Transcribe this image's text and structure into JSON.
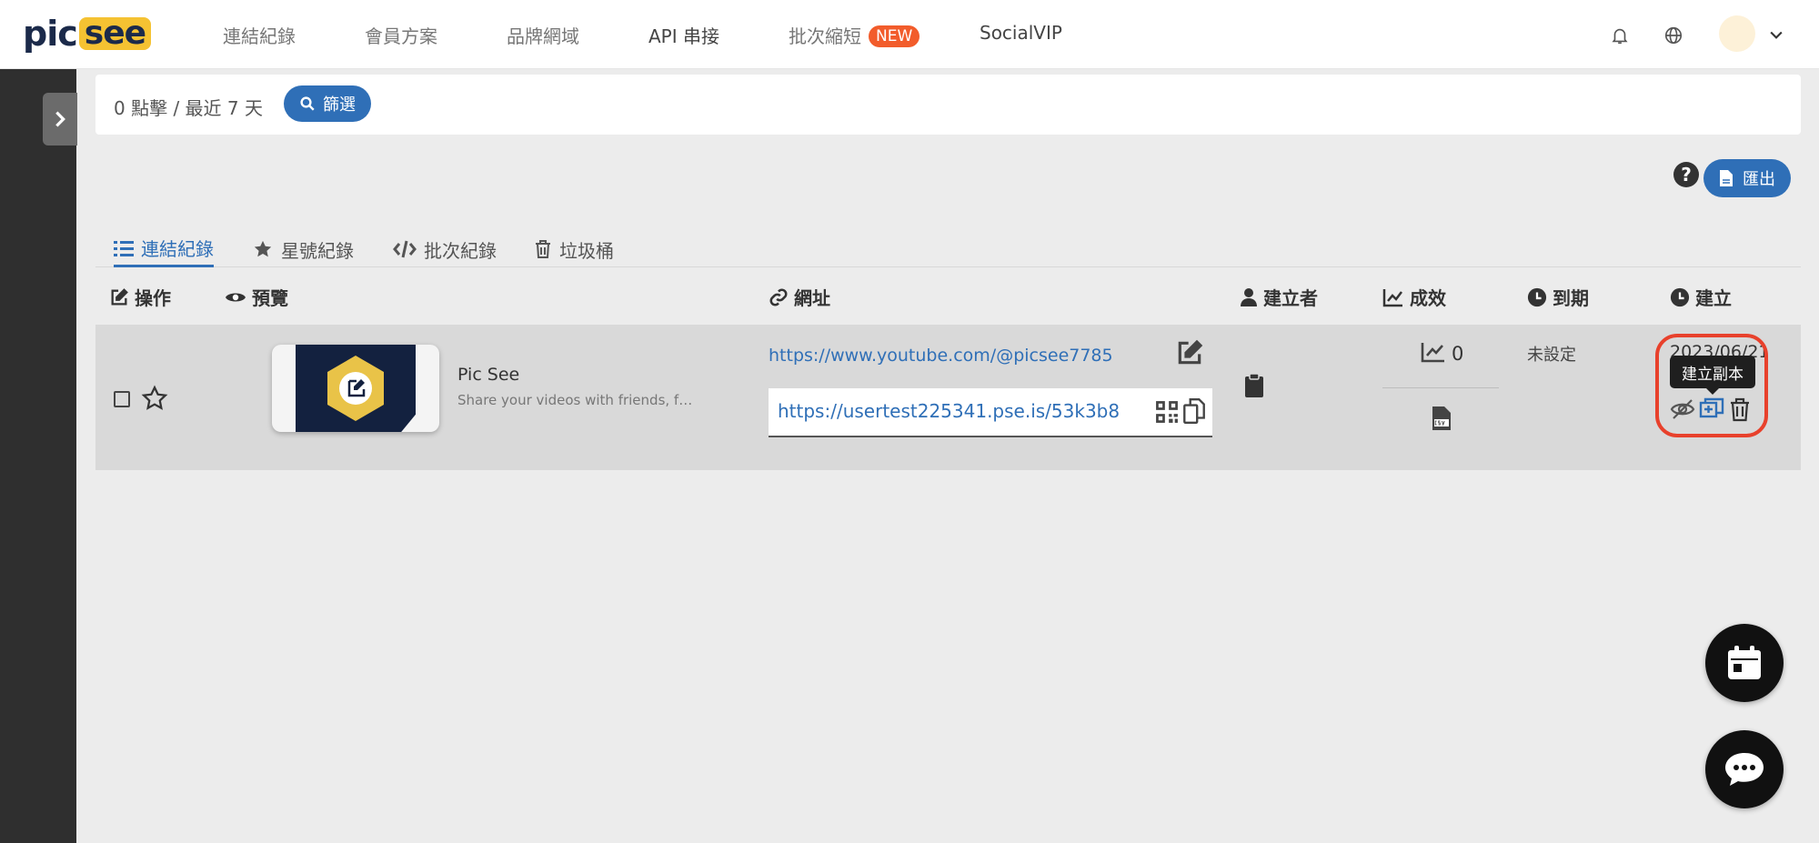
{
  "logo": {
    "part1": "pic",
    "part2": "see"
  },
  "nav": {
    "items": [
      {
        "label": "連結紀錄"
      },
      {
        "label": "會員方案"
      },
      {
        "label": "品牌網域"
      },
      {
        "label": "API 串接"
      },
      {
        "label": "批次縮短",
        "badge": "NEW"
      },
      {
        "label": "SocialVIP"
      }
    ],
    "icons": [
      "bell-icon",
      "globe-icon",
      "chevron-down-icon"
    ]
  },
  "filter": {
    "summary": "0 點擊 / 最近 7 天",
    "button_label": "篩選"
  },
  "export": {
    "label": "匯出",
    "help": "?"
  },
  "tabs": [
    {
      "label": "連結紀錄",
      "icon": "list-icon",
      "active": true
    },
    {
      "label": "星號紀錄",
      "icon": "star-icon"
    },
    {
      "label": "批次紀錄",
      "icon": "code-icon"
    },
    {
      "label": "垃圾桶",
      "icon": "trash-icon"
    }
  ],
  "columns": {
    "action": "操作",
    "preview": "預覽",
    "url": "網址",
    "creator": "建立者",
    "performance": "成效",
    "expiry": "到期",
    "created": "建立"
  },
  "row": {
    "preview_title": "Pic See",
    "preview_desc": "Share your videos with friends, family...",
    "original_url": "https://www.youtube.com/@picsee7785",
    "short_url": "https://usertest225341.pse.is/53k3b8",
    "clicks": "0",
    "expiry": "未設定",
    "created": "2023/06/21",
    "tooltip": "建立副本"
  },
  "colors": {
    "accent": "#2f6fb7",
    "sidebar": "#2f2f2f",
    "badge": "#f25c2b",
    "highlight": "#e8412c",
    "logo_yellow": "#f5c232",
    "logo_navy": "#1b2a4a"
  }
}
